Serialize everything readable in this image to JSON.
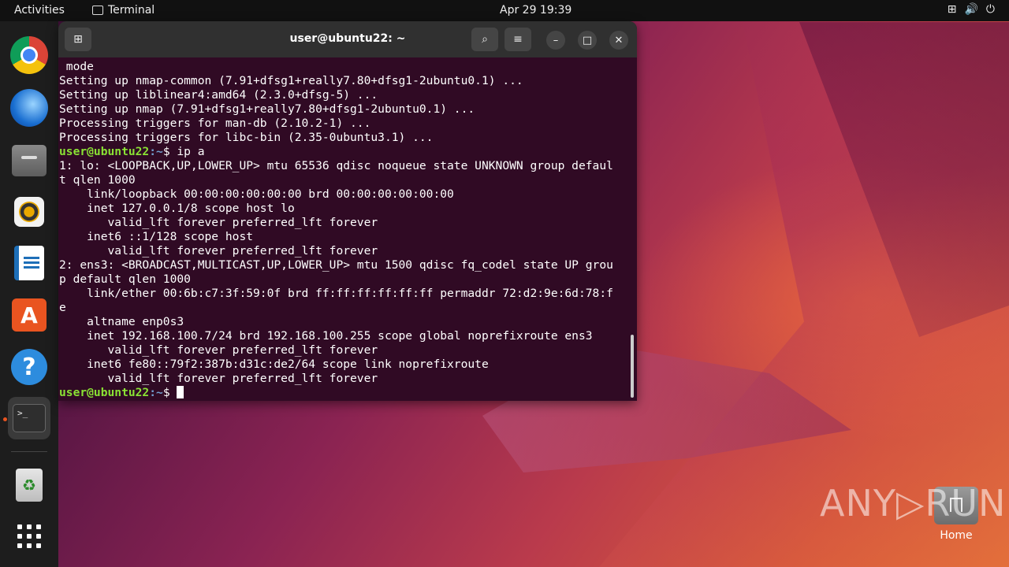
{
  "topbar": {
    "activities": "Activities",
    "app_name": "Terminal",
    "clock": "Apr 29  19:39",
    "tray_icons": [
      "network-icon",
      "volume-icon",
      "power-icon"
    ]
  },
  "dock": {
    "items": [
      {
        "name": "chrome",
        "icon": "chrome-icon"
      },
      {
        "name": "thunderbird",
        "icon": "thunderbird-icon"
      },
      {
        "name": "files",
        "icon": "files-icon"
      },
      {
        "name": "rhythmbox",
        "icon": "rhythmbox-icon"
      },
      {
        "name": "writer",
        "icon": "libreoffice-writer-icon"
      },
      {
        "name": "software",
        "icon": "app-center-icon"
      },
      {
        "name": "help",
        "icon": "help-icon"
      },
      {
        "name": "terminal",
        "icon": "terminal-icon",
        "active": true
      },
      {
        "name": "trash",
        "icon": "trash-icon"
      },
      {
        "name": "show-apps",
        "icon": "app-grid-icon"
      }
    ],
    "store_glyph": "A",
    "help_glyph": "?",
    "terminal_glyph": ">_",
    "trash_glyph": "♻"
  },
  "terminal": {
    "title": "user@ubuntu22: ~",
    "prompt_user": "user@ubuntu22",
    "prompt_path": ":~",
    "lines": [
      " mode",
      "Setting up nmap-common (7.91+dfsg1+really7.80+dfsg1-2ubuntu0.1) ...",
      "Setting up liblinear4:amd64 (2.3.0+dfsg-5) ...",
      "Setting up nmap (7.91+dfsg1+really7.80+dfsg1-2ubuntu0.1) ...",
      "Processing triggers for man-db (2.10.2-1) ...",
      "Processing triggers for libc-bin (2.35-0ubuntu3.1) ...",
      "$ ip a",
      "1: lo: <LOOPBACK,UP,LOWER_UP> mtu 65536 qdisc noqueue state UNKNOWN group defaul",
      "t qlen 1000",
      "    link/loopback 00:00:00:00:00:00 brd 00:00:00:00:00:00",
      "    inet 127.0.0.1/8 scope host lo",
      "       valid_lft forever preferred_lft forever",
      "    inet6 ::1/128 scope host",
      "       valid_lft forever preferred_lft forever",
      "2: ens3: <BROADCAST,MULTICAST,UP,LOWER_UP> mtu 1500 qdisc fq_codel state UP grou",
      "p default qlen 1000",
      "    link/ether 00:6b:c7:3f:59:0f brd ff:ff:ff:ff:ff:ff permaddr 72:d2:9e:6d:78:f",
      "e",
      "    altname enp0s3",
      "    inet 192.168.100.7/24 brd 192.168.100.255 scope global noprefixroute ens3",
      "       valid_lft forever preferred_lft forever",
      "    inet6 fe80::79f2:387b:d31c:de2/64 scope link noprefixroute",
      "       valid_lft forever preferred_lft forever",
      "$ "
    ]
  },
  "desktop": {
    "home_label": "Home",
    "watermark": "ANY▷RUN"
  }
}
